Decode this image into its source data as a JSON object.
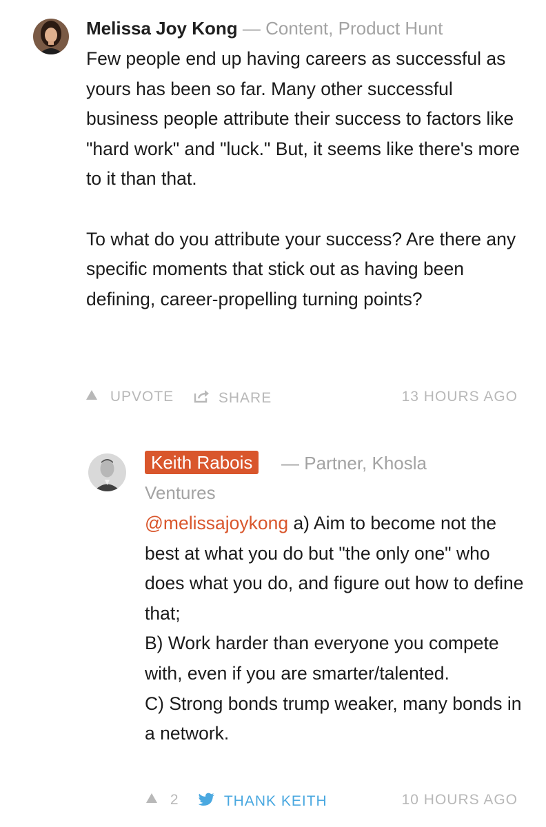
{
  "colors": {
    "accent": "#d9562c",
    "muted": "#a3a3a3",
    "twitter": "#4aa8e0"
  },
  "comments": [
    {
      "author": "Melissa Joy Kong",
      "separator": "—",
      "role": "Content, Product Hunt",
      "paragraphs": [
        "Few people end up having careers as successful as yours has been so far. Many other successful business people attribute their success to factors like \"hard work\" and \"luck.\" But, it seems like there's more to it than that.",
        "To what do you attribute your success? Are there any specific moments that stick out as having been defining, career-propelling turning points?"
      ],
      "upvote_label": "UPVOTE",
      "share_label": "SHARE",
      "timestamp": "13 HOURS AGO",
      "icons": [
        "avatar",
        "upvote-arrow-icon",
        "share-icon"
      ]
    },
    {
      "author": "Keith Rabois",
      "separator": "—",
      "role_line1": "Partner, Khosla",
      "role_line2": "Ventures",
      "mention": "@melissajoykong",
      "lines": [
        " a) Aim to become not the best at what you do but \"the only one\" who does what you do, and figure out how to define that;",
        "B) Work harder than everyone you compete with, even if you are smarter/talented.",
        "C) Strong bonds trump weaker, many bonds in a network."
      ],
      "upvote_count": "2",
      "thank_label": "THANK KEITH",
      "timestamp": "10 HOURS AGO",
      "icons": [
        "avatar",
        "upvote-arrow-icon",
        "twitter-bird-icon"
      ]
    }
  ]
}
